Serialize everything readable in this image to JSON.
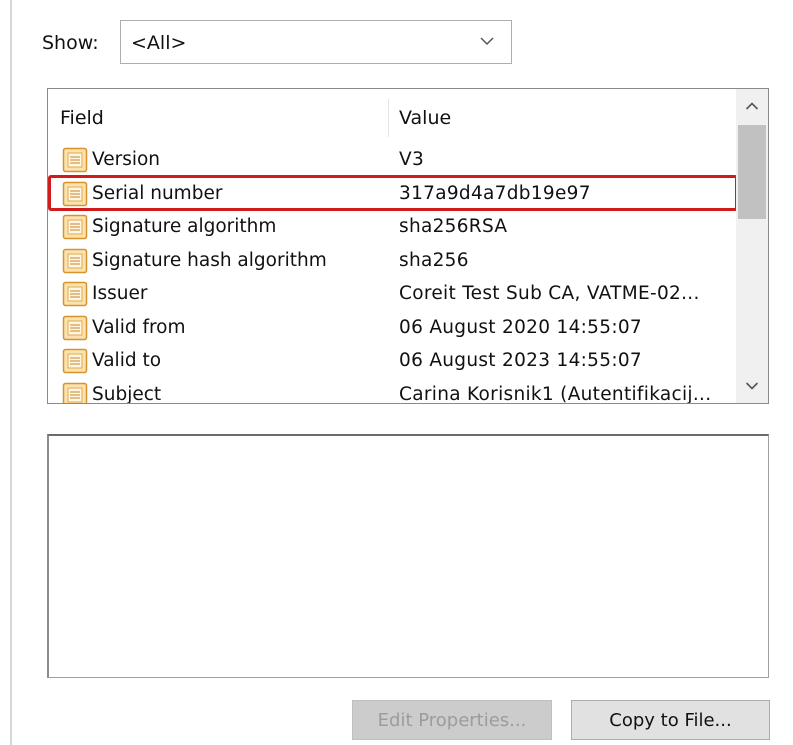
{
  "show": {
    "label": "Show:",
    "selected": "<All>",
    "icon": "chevron-down-icon"
  },
  "list": {
    "columns": {
      "field": "Field",
      "value": "Value"
    },
    "rows": [
      {
        "field": "Version",
        "value": "V3"
      },
      {
        "field": "Serial number",
        "value": "317a9d4a7db19e97"
      },
      {
        "field": "Signature algorithm",
        "value": "sha256RSA"
      },
      {
        "field": "Signature hash algorithm",
        "value": "sha256"
      },
      {
        "field": "Issuer",
        "value": "Coreit Test Sub CA, VATME-02..."
      },
      {
        "field": "Valid from",
        "value": "06 August 2020 14:55:07"
      },
      {
        "field": "Valid to",
        "value": "06 August 2023 14:55:07"
      },
      {
        "field": "Subject",
        "value": "Carina Korisnik1 (Autentifikacij..."
      }
    ],
    "highlighted_row": "Serial number",
    "highlight_color": "#d11b1b",
    "row_icon": "certificate-field-icon",
    "row_icon_color": "#f0b44a"
  },
  "detail": {
    "text": ""
  },
  "buttons": {
    "edit_properties": "Edit Properties...",
    "copy_to_file": "Copy to File..."
  }
}
